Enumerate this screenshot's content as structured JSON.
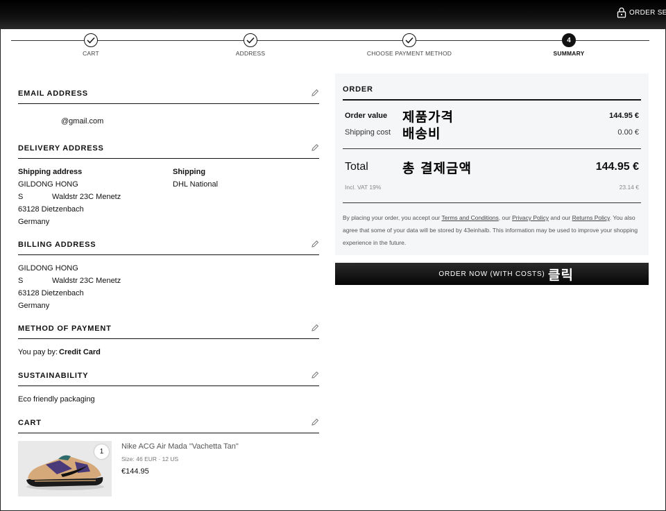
{
  "header": {
    "order_secure": "ORDER SEC"
  },
  "steps": [
    {
      "label": "CART",
      "status": "done"
    },
    {
      "label": "ADDRESS",
      "status": "done"
    },
    {
      "label": "CHOOSE PAYMENT METHOD",
      "status": "done"
    },
    {
      "label": "SUMMARY",
      "status": "active",
      "number": "4"
    }
  ],
  "email": {
    "title": "EMAIL ADDRESS",
    "value": "@gmail.com"
  },
  "delivery": {
    "title": "DELIVERY ADDRESS",
    "shipping_address_label": "Shipping address",
    "name": "GILDONG HONG",
    "street_prefix": "S",
    "street": "Waldstr 23C Menetz",
    "city": "63128 Dietzenbach",
    "country": "Germany",
    "shipping_label": "Shipping",
    "shipping_method": "DHL National"
  },
  "billing": {
    "title": "BILLING ADDRESS",
    "name": "GILDONG HONG",
    "street_prefix": "S",
    "street": "Waldstr 23C Menetz",
    "city": "63128 Dietzenbach",
    "country": "Germany"
  },
  "payment": {
    "title": "METHOD OF PAYMENT",
    "prefix": "You pay by:",
    "method": "Credit Card"
  },
  "sustainability": {
    "title": "SUSTAINABILITY",
    "value": "Eco friendly packaging"
  },
  "cart": {
    "title": "CART",
    "items": [
      {
        "quantity": "1",
        "name": "Nike ACG Air Mada \"Vachetta Tan\"",
        "size": "Size: 46 EUR · 12 US",
        "price": "€144.95"
      }
    ]
  },
  "order": {
    "title": "ORDER",
    "order_value_label": "Order value",
    "order_value_annotation": "제품가격",
    "order_value": "144.95 €",
    "shipping_cost_label": "Shipping cost",
    "shipping_cost_annotation": "배송비",
    "shipping_cost": "0.00 €",
    "total_label": "Total",
    "total_annotation": "총 결제금액",
    "total": "144.95 €",
    "vat_label": "Incl. VAT 19%",
    "vat_value": "23.14 €",
    "legal": {
      "part1": "By placing your order, you accept our ",
      "terms": "Terms and Conditions",
      "part2": ", our ",
      "privacy": "Privacy Policy",
      "part3": " and our ",
      "returns": "Returns Policy",
      "part4": ". You also agree that some of your data will be stored by 43einhalb. This information may be used to improve your shopping experience in the future."
    },
    "button_label": "ORDER NOW (WITH COSTS)",
    "button_annotation": "클릭"
  }
}
